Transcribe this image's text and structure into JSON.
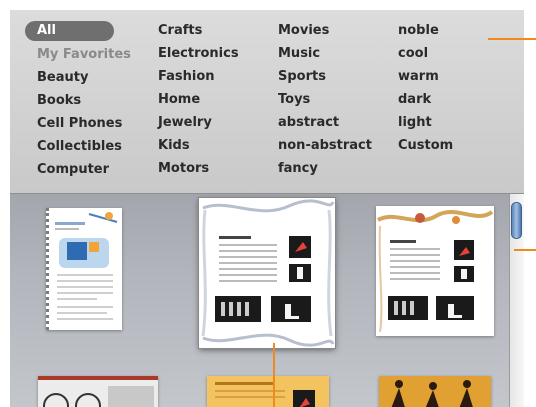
{
  "menu": {
    "columns": [
      [
        "All",
        "My Favorites",
        "Beauty",
        "Books",
        "Cell Phones",
        "Collectibles",
        "Computer"
      ],
      [
        "Crafts",
        "Electronics",
        "Fashion",
        "Home",
        "Jewelry",
        "Kids",
        "Motors"
      ],
      [
        "Movies",
        "Music",
        "Sports",
        "Toys",
        "abstract",
        "non-abstract",
        "fancy"
      ],
      [
        "noble",
        "cool",
        "warm",
        "dark",
        "light",
        "Custom"
      ]
    ],
    "selected": "All"
  },
  "colors": {
    "accent_callout": "#f08a1c",
    "selected_pill": "#6f6f6f",
    "scroll_thumb": "#6f95c6"
  }
}
